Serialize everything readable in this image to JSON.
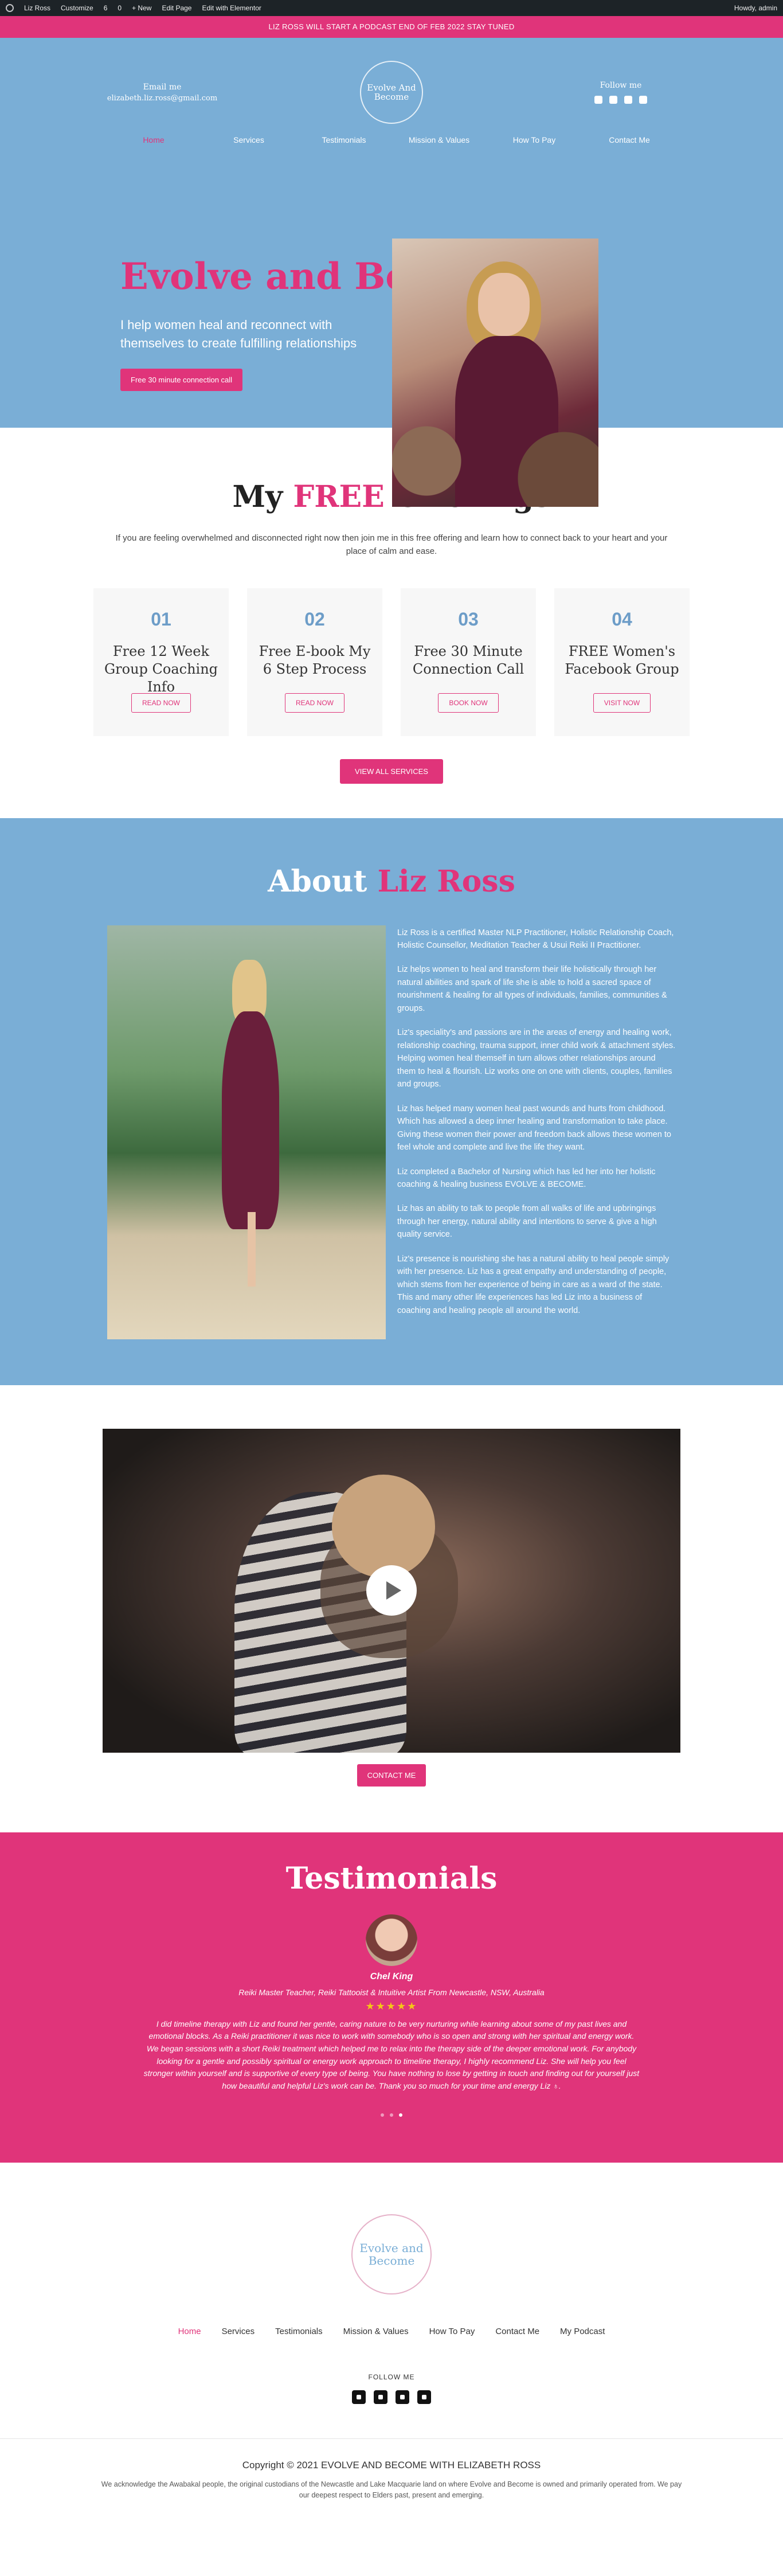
{
  "adminbar": {
    "items": [
      "Liz Ross",
      "Customize",
      "6",
      "0",
      "+ New",
      "Edit Page",
      "Edit with Elementor"
    ],
    "howdy": "Howdy, admin"
  },
  "announcement": "LIZ ROSS WILL START A PODCAST END OF FEB 2022 STAY TUNED",
  "header": {
    "email_label": "Email me",
    "email_value": "elizabeth.liz.ross@gmail.com",
    "logo_line1": "Evolve And",
    "logo_line2": "Become",
    "follow_label": "Follow me",
    "social_icons": [
      "facebook-icon",
      "instagram-icon",
      "linkedin-icon",
      "youtube-icon"
    ]
  },
  "nav": {
    "items": [
      "Home",
      "Services",
      "Testimonials",
      "Mission & Values",
      "How To Pay",
      "Contact Me"
    ],
    "active": "Home"
  },
  "hero": {
    "title": "Evolve and Become",
    "subtitle": "I help women heal and reconnect with themselves to create fulfilling relationships",
    "cta": "Free 30 minute connection call"
  },
  "offerings": {
    "title_pre": "My",
    "title_pink": "FREE",
    "title_post": "Offerings",
    "intro": "If you are feeling overwhelmed and disconnected right now then join me in this free offering and learn how to connect back to your heart and your place of calm and ease.",
    "cards": [
      {
        "num": "01",
        "title": "Free 12 Week Group Coaching Info",
        "button": "READ NOW"
      },
      {
        "num": "02",
        "title": "Free E-book My 6 Step Process",
        "button": "READ NOW"
      },
      {
        "num": "03",
        "title": "Free 30 Minute Connection Call",
        "button": "BOOK NOW"
      },
      {
        "num": "04",
        "title": "FREE Women's Facebook Group",
        "button": "VISIT NOW"
      }
    ],
    "view_all": "VIEW ALL SERVICES"
  },
  "about": {
    "title_pre": "About",
    "title_pink": "Liz Ross",
    "paragraphs": [
      "Liz Ross is a certified Master NLP Practitioner, Holistic Relationship Coach, Holistic Counsellor, Meditation Teacher & Usui Reiki II Practitioner.",
      "Liz helps women to heal and transform their life holistically through her natural abilities and spark of life she is able to hold a sacred space of nourishment & healing for all types of individuals, families, communities & groups.",
      "Liz's speciality's and passions are in the areas of energy and healing work, relationship coaching, trauma support, inner child work & attachment styles. Helping women heal themself in turn allows other relationships around them to heal & flourish. Liz works one on one with clients, couples, families and groups.",
      "Liz has helped many women heal past wounds and hurts from childhood. Which has allowed a deep inner healing and transformation to take place. Giving these women their power and freedom back allows these women to feel whole and complete and live the life they want.",
      "Liz completed a Bachelor of Nursing which has led her into her holistic coaching & healing business EVOLVE & BECOME.",
      "Liz has an ability to talk to people from all walks of life and upbringings through her energy, natural ability and intentions to serve & give a high quality service.",
      "Liz's presence is nourishing she has a natural ability to heal people simply with her presence. Liz has a great empathy and understanding of people, which stems from her experience of being in care as a ward of the state. This and many other life experiences has led Liz into a business of coaching and healing people all around the world."
    ]
  },
  "video": {
    "contact_button": "CONTACT ME"
  },
  "testimonials": {
    "title": "Testimonials",
    "name": "Chel King",
    "role": "Reiki Master Teacher, Reiki Tattooist & Intuitive Artist From Newcastle, NSW, Australia",
    "stars": "★★★★★",
    "rating": 5,
    "quote": "I did timeline therapy with Liz and found her gentle, caring nature to be very nurturing while learning about some of my past lives and emotional blocks. As a Reiki practitioner it was nice to work with somebody who is so open and strong with her spiritual and energy work. We began sessions with a short Reiki treatment which helped me to relax into the therapy side of the deeper emotional work. For anybody looking for a gentle and possibly spiritual or energy work approach to timeline therapy, I highly recommend Liz. She will help you feel stronger within yourself and is supportive of every type of being. You have nothing to lose by getting in touch and finding out for yourself just how beautiful and helpful Liz's work can be. Thank you so much for your time and energy Liz ♁."
  },
  "footer": {
    "logo_line1": "Evolve and",
    "logo_line2": "Become",
    "nav": [
      "Home",
      "Services",
      "Testimonials",
      "Mission & Values",
      "How To Pay",
      "Contact Me",
      "My Podcast"
    ],
    "follow": "FOLLOW ME",
    "copyright": "Copyright © 2021 EVOLVE AND BECOME WITH ELIZABETH ROSS",
    "acknowledgement": "We acknowledge the Awabakal people, the original custodians of the Newcastle and Lake Macquarie land on where Evolve and Become is owned and primarily operated from. We pay our deepest respect to Elders past, present and emerging."
  },
  "colors": {
    "pink": "#e0347a",
    "blue": "#7aaed6",
    "number_blue": "#6d9dc8"
  }
}
